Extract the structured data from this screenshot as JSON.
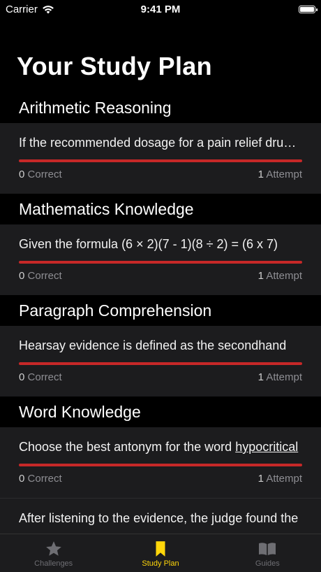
{
  "status": {
    "carrier": "Carrier",
    "time": "9:41 PM"
  },
  "page_title": "Your Study Plan",
  "sections": [
    {
      "title": "Arithmetic Reasoning",
      "question": "If the recommended dosage for a pain relief drug is",
      "correct_count": "0",
      "correct_label": "Correct",
      "attempt_count": "1",
      "attempt_label": "Attempt",
      "progress": 0
    },
    {
      "title": "Mathematics Knowledge",
      "question": "Given the formula (6 × 2)(7 - 1)(8 ÷ 2) = (6 x 7)",
      "correct_count": "0",
      "correct_label": "Correct",
      "attempt_count": "1",
      "attempt_label": "Attempt",
      "progress": 0
    },
    {
      "title": "Paragraph Comprehension",
      "question": "Hearsay evidence is defined as the secondhand",
      "correct_count": "0",
      "correct_label": "Correct",
      "attempt_count": "1",
      "attempt_label": "Attempt",
      "progress": 0
    },
    {
      "title": "Word Knowledge",
      "question_prefix": "Choose the best antonym for the word ",
      "question_underlined": "hypocritical",
      "correct_count": "0",
      "correct_label": "Correct",
      "attempt_count": "1",
      "attempt_label": "Attempt",
      "progress": 0
    }
  ],
  "extra_question": "After listening to the evidence, the judge found the",
  "tabs": [
    {
      "label": "Challenges",
      "icon": "star-icon",
      "active": false
    },
    {
      "label": "Study Plan",
      "icon": "bookmark-icon",
      "active": true
    },
    {
      "label": "Guides",
      "icon": "book-icon",
      "active": false
    }
  ],
  "colors": {
    "accent": "#ffd60a",
    "progress_bar": "#c62828",
    "card_bg": "#1c1c1e"
  }
}
